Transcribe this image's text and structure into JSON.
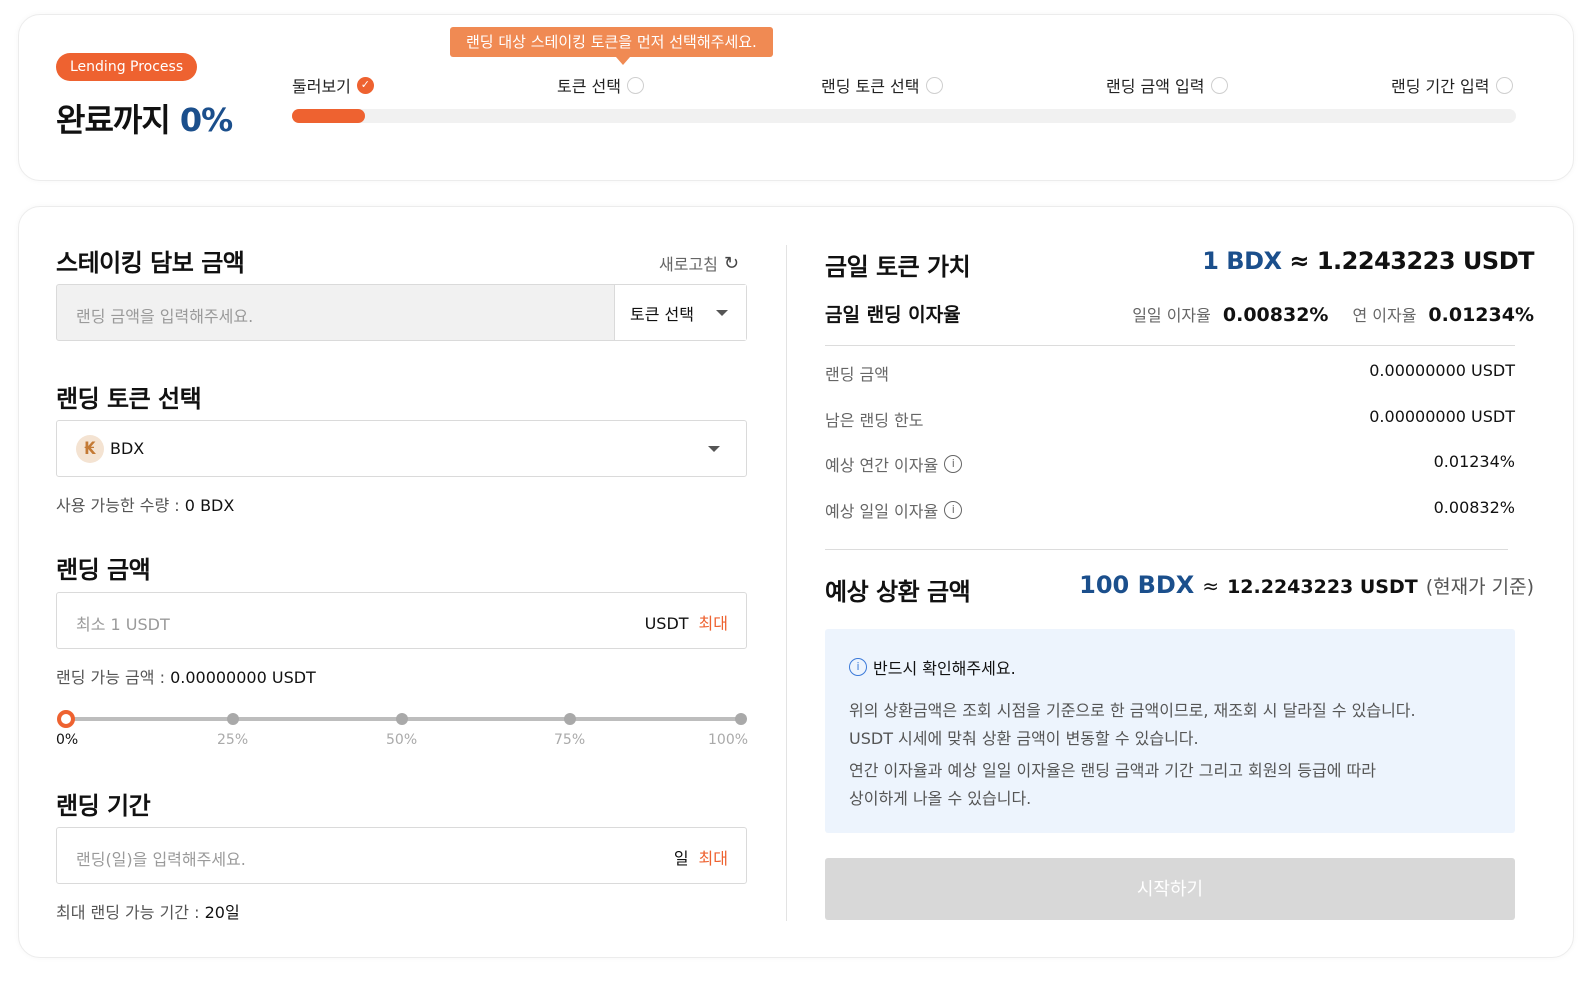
{
  "process": {
    "badge": "Lending Process",
    "title_prefix": "완료까지",
    "percent_text": "0%",
    "progress": 0.06,
    "tooltip": "랜딩 대상 스테이킹 토큰을 먼저 선택해주세요.",
    "steps": [
      {
        "label": "둘러보기",
        "done": true
      },
      {
        "label": "토큰 선택",
        "done": false
      },
      {
        "label": "랜딩 토큰 선택",
        "done": false
      },
      {
        "label": "랜딩 금액 입력",
        "done": false
      },
      {
        "label": "랜딩 기간 입력",
        "done": false
      }
    ]
  },
  "left": {
    "collateral": {
      "title": "스테이킹 담보 금액",
      "refresh_label": "새로고침",
      "placeholder": "랜딩 금액을 입력해주세요.",
      "token_select_label": "토큰 선택"
    },
    "lending_token": {
      "title": "랜딩 토큰 선택",
      "token_name": "BDX",
      "available_label": "사용 가능한 수량 :",
      "available_value": "0 BDX"
    },
    "lending_amount": {
      "title": "랜딩 금액",
      "placeholder": "최소 1 USDT",
      "unit": "USDT",
      "max_label": "최대",
      "available_label": "랜딩 가능 금액 :",
      "available_value": "0.00000000 USDT",
      "slider_labels": [
        "0%",
        "25%",
        "50%",
        "75%",
        "100%"
      ],
      "slider_value": 0
    },
    "lending_period": {
      "title": "랜딩 기간",
      "placeholder": "랜딩(일)을 입력해주세요.",
      "unit": "일",
      "max_label": "최대",
      "max_period_label": "최대 랜딩 가능 기간 :",
      "max_period_value": "20일"
    }
  },
  "right": {
    "token_value_title": "금일 토큰 가치",
    "token_value_bdx": "1 BDX",
    "approx": "≈",
    "token_value_usdt": "1.2243223 USDT",
    "rate_title": "금일 랜딩 이자율",
    "daily_rate_label": "일일 이자율",
    "daily_rate_value": "0.00832%",
    "annual_rate_label": "연 이자율",
    "annual_rate_value": "0.01234%",
    "rows": [
      {
        "label": "랜딩 금액",
        "value": "0.00000000 USDT"
      },
      {
        "label": "남은 랜딩 한도",
        "value": "0.00000000 USDT"
      },
      {
        "label": "예상 연간 이자율",
        "value": "0.01234%"
      },
      {
        "label": "예상 일일 이자율",
        "value": "0.00832%"
      }
    ],
    "repay_title": "예상 상환 금액",
    "repay_bdx": "100 BDX",
    "repay_usdt": "12.2243223 USDT",
    "repay_basis": "(현재가 기준)",
    "notice_title": "반드시 확인해주세요.",
    "notice_lines": [
      "위의 상환금액은 조회 시점을 기준으로 한 금액이므로, 재조회 시 달라질 수 있습니다.",
      "USDT 시세에 맞춰 상환 금액이 변동할 수 있습니다.",
      "연간 이자율과 예상 일일 이자율은 랜딩 금액과 기간 그리고 회원의 등급에 따라",
      "상이하게 나올 수 있습니다."
    ],
    "start_button": "시작하기"
  },
  "colors": {
    "accent": "#ee6230",
    "tooltip": "#f08a53",
    "blue": "#1b4f8c",
    "notice_bg": "#edf4fd",
    "disabled_button": "#d8d8d8"
  },
  "icons": [
    "check-icon",
    "refresh-icon",
    "chevron-down-icon",
    "bdx-token-icon",
    "info-icon"
  ]
}
